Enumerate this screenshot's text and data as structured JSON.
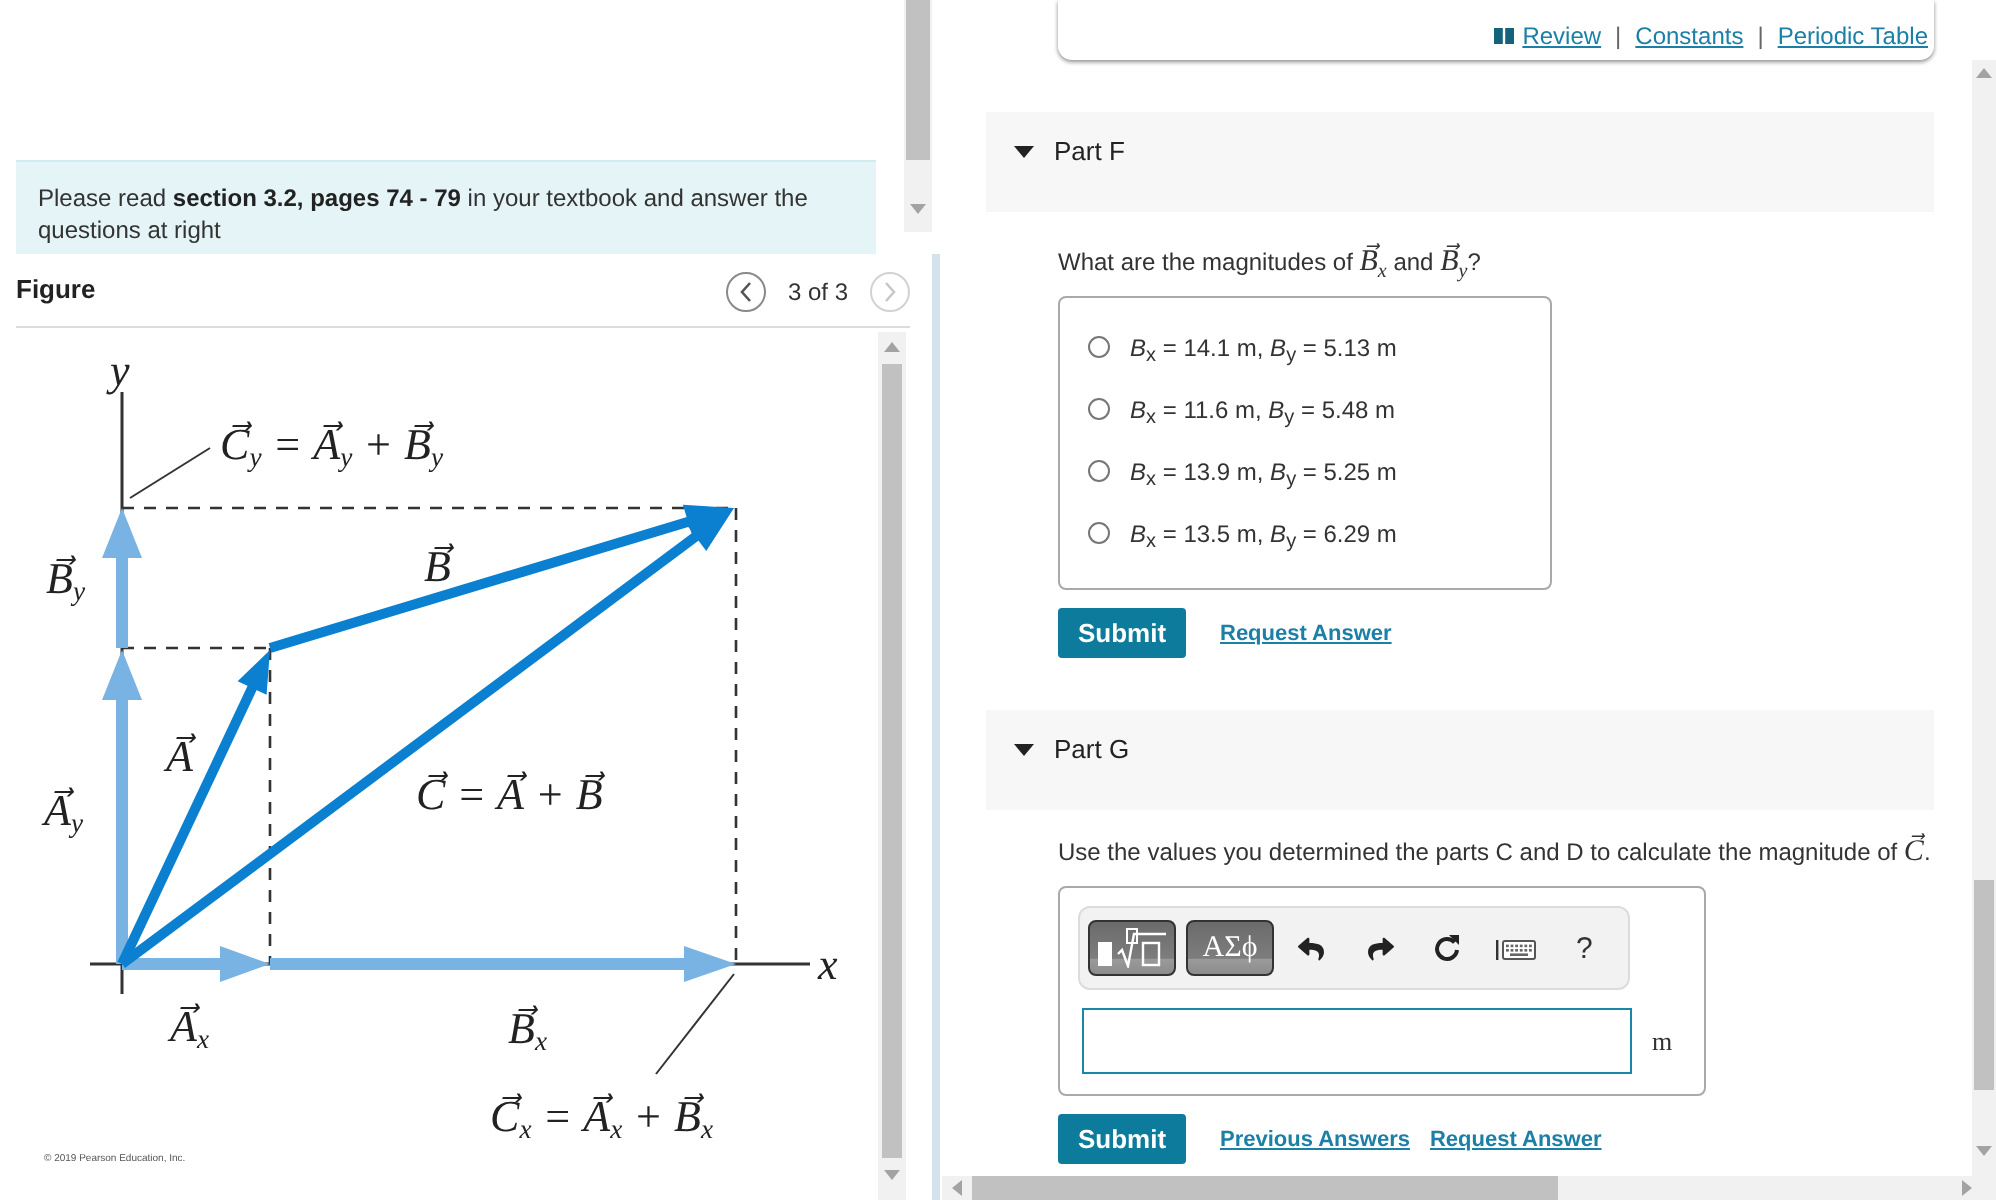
{
  "instructions": {
    "text": "Please read **section 3.2, pages 74 - 79** in your textbook and answer the questions at right"
  },
  "figure": {
    "title": "Figure",
    "counter": "3 of 3",
    "prev": {
      "disabled": false
    },
    "next": {
      "disabled": true
    },
    "labels": [
      {
        "text": "y"
      },
      {
        "text": "C⃗$_{y}$ = A⃗$_{y}$ + B⃗$_{y}$"
      },
      {
        "text": "B⃗$_{y}$"
      },
      {
        "text": "B⃗"
      },
      {
        "text": "A⃗"
      },
      {
        "text": "A⃗$_{y}$"
      },
      {
        "text": "C⃗ = A⃗ + B⃗"
      },
      {
        "text": "x"
      },
      {
        "text": "A⃗$_{x}$"
      },
      {
        "text": "B⃗$_{x}$"
      },
      {
        "text": "C⃗$_{x}$ = A⃗$_{x}$ + B⃗$_{x}$"
      }
    ],
    "credit": "© 2019 Pearson Education, Inc."
  },
  "header_links": {
    "separator": "|",
    "items": [
      {
        "label": "Review",
        "kind": "book"
      },
      {
        "label": "Constants",
        "kind": "plain"
      },
      {
        "label": "Periodic Table",
        "kind": "plain"
      }
    ]
  },
  "parts": [
    {
      "title": "Part F",
      "expanded": true,
      "kind": "choice",
      "question": "What are the magnitudes of *B⃗*$_{x}$ and *B⃗*$_{y}$?",
      "options": [
        {
          "text": "*B*$_{x}$ = 14.1 m, *B*$_{y}$ = 5.13 m",
          "selected": false
        },
        {
          "text": "*B*$_{x}$ = 11.6 m, *B*$_{y}$ = 5.48 m",
          "selected": false
        },
        {
          "text": "*B*$_{x}$ = 13.9 m, *B*$_{y}$ = 5.25 m",
          "selected": false
        },
        {
          "text": "*B*$_{x}$ = 13.5 m, *B*$_{y}$ = 6.29 m",
          "selected": false
        }
      ],
      "buttons": [
        {
          "kind": "submit",
          "label": "Submit"
        },
        {
          "kind": "link",
          "label": "Request Answer"
        }
      ]
    },
    {
      "title": "Part G",
      "expanded": true,
      "kind": "input",
      "question": "Use the values you determined the parts C and D to calculate the magnitude of *C⃗*.",
      "toolbar": [
        {
          "kind": "templates"
        },
        {
          "kind": "symbols",
          "label": "ΑΣϕ"
        },
        {
          "kind": "undo"
        },
        {
          "kind": "redo"
        },
        {
          "kind": "reset"
        },
        {
          "kind": "keyboard"
        },
        {
          "kind": "help",
          "label": "?"
        }
      ],
      "answer": {
        "unit": "m"
      },
      "buttons": [
        {
          "kind": "submit",
          "label": "Submit"
        },
        {
          "kind": "link",
          "label": "Previous Answers"
        },
        {
          "kind": "link",
          "label": "Request Answer"
        }
      ]
    }
  ]
}
